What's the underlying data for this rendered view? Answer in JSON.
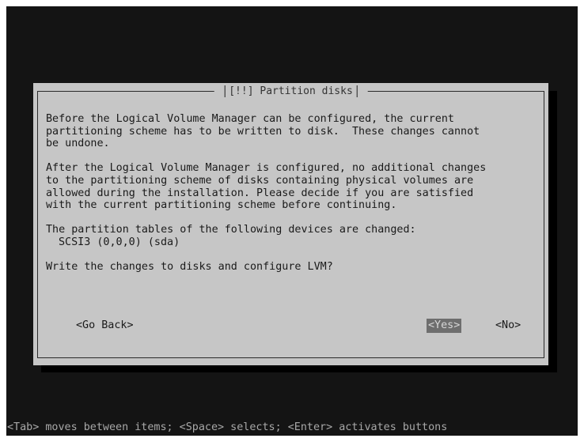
{
  "dialog": {
    "title_prefix": "[!!]",
    "title_text": "Partition disks",
    "paragraph1": [
      "Before the Logical Volume Manager can be configured, the current",
      "partitioning scheme has to be written to disk.  These changes cannot",
      "be undone."
    ],
    "paragraph2": [
      "After the Logical Volume Manager is configured, no additional changes",
      "to the partitioning scheme of disks containing physical volumes are",
      "allowed during the installation. Please decide if you are satisfied",
      "with the current partitioning scheme before continuing."
    ],
    "paragraph3_intro": "The partition tables of the following devices are changed:",
    "devices": [
      "SCSI3 (0,0,0) (sda)"
    ],
    "question": "Write the changes to disks and configure LVM?",
    "buttons": {
      "go_back": "<Go Back>",
      "yes": "<Yes>",
      "no": "<No>"
    }
  },
  "statusbar": {
    "help_text": "<Tab> moves between items; <Space> selects; <Enter> activates buttons"
  },
  "colors": {
    "screen_bg": "#141414",
    "dialog_bg": "#c6c6c6",
    "selected_button_bg": "#6e6e6e"
  }
}
